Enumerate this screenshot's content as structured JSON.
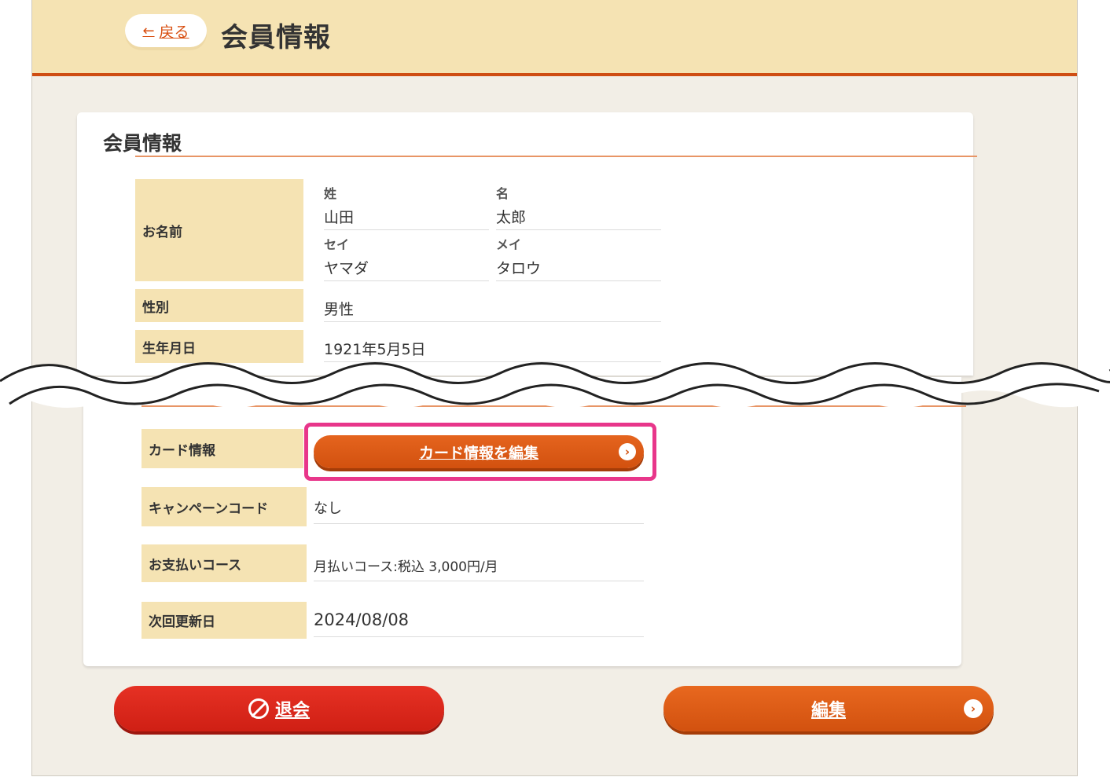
{
  "header": {
    "back_label": "戻る",
    "title": "会員情報"
  },
  "member_section": {
    "title": "会員情報",
    "name_label": "お名前",
    "last_name_label": "姓",
    "last_name": "山田",
    "first_name_label": "名",
    "first_name": "太郎",
    "last_name_kana_label": "セイ",
    "last_name_kana": "ヤマダ",
    "first_name_kana_label": "メイ",
    "first_name_kana": "タロウ",
    "gender_label": "性別",
    "gender": "男性",
    "birthday_label": "生年月日",
    "birthday": "1921年5月5日"
  },
  "payment_section": {
    "card_label": "カード情報",
    "card_edit_button": "カード情報を編集",
    "campaign_label": "キャンペーンコード",
    "campaign_value": "なし",
    "course_label": "お支払いコース",
    "course_value": "月払いコース:税込 3,000円/月",
    "renewal_label": "次回更新日",
    "renewal_value": "2024/08/08"
  },
  "actions": {
    "withdraw_label": "退会",
    "edit_label": "編集"
  },
  "colors": {
    "accent_orange": "#d2510f",
    "withdraw_red": "#cf1f14",
    "label_bg": "#f5e3b3",
    "highlight_pink": "#e8368a"
  }
}
